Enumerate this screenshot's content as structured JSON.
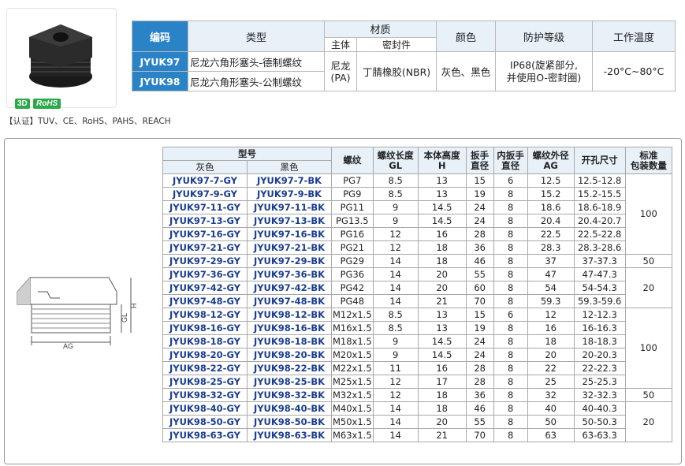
{
  "header_table": {
    "col_code": "编码",
    "col_type": "类型",
    "col_material": "材质",
    "col_material_main": "主体",
    "col_material_seal": "密封件",
    "col_color": "颜色",
    "col_protection": "防护等级",
    "col_temp": "工作温度",
    "rows": [
      {
        "code": "JYUK97",
        "type": "尼龙六角形塞头-德制螺纹"
      },
      {
        "code": "JYUK98",
        "type": "尼龙六角形塞头-公制螺纹"
      }
    ],
    "material_main": "尼龙\n(PA)",
    "material_seal": "丁腈橡胶(NBR)",
    "color": "灰色、黑色",
    "protection": "IP68(旋紧部分,\n并使用O-密封圈)",
    "temp": "-20°C~80°C"
  },
  "badges": {
    "three_d": "3D",
    "rohs": "RoHS"
  },
  "certification": "【认证】TUV、CE、RoHS、PAHS、REACH",
  "drawing_labels": {
    "gl": "GL",
    "h": "H",
    "ag": "AG"
  },
  "spec_table": {
    "model": "型号",
    "gray": "灰色",
    "black": "黑色",
    "thread": "螺纹",
    "gl": "螺纹长度\nGL",
    "h": "本体高度\nH",
    "wrench": "扳手\n直径",
    "inner_wrench": "内扳手\n直径",
    "ag": "螺纹外径\nAG",
    "hole": "开孔尺寸",
    "pack": "标准\n包装数量",
    "rows": [
      [
        "JYUK97-7-GY",
        "JYUK97-7-BK",
        "PG7",
        "8.5",
        "13",
        "15",
        "6",
        "12.5",
        "12.5-12.8"
      ],
      [
        "JYUK97-9-GY",
        "JYUK97-9-BK",
        "PG9",
        "8.5",
        "13",
        "19",
        "8",
        "15.2",
        "15.2-15.5"
      ],
      [
        "JYUK97-11-GY",
        "JYUK97-11-BK",
        "PG11",
        "9",
        "14.5",
        "24",
        "8",
        "18.6",
        "18.6-18.9"
      ],
      [
        "JYUK97-13-GY",
        "JYUK97-13-BK",
        "PG13.5",
        "9",
        "14.5",
        "24",
        "8",
        "20.4",
        "20.4-20.7"
      ],
      [
        "JYUK97-16-GY",
        "JYUK97-16-BK",
        "PG16",
        "12",
        "16",
        "28",
        "8",
        "22.5",
        "22.5-22.8"
      ],
      [
        "JYUK97-21-GY",
        "JYUK97-21-BK",
        "PG21",
        "12",
        "18",
        "36",
        "8",
        "28.3",
        "28.3-28.6"
      ],
      [
        "JYUK97-29-GY",
        "JYUK97-29-BK",
        "PG29",
        "14",
        "18",
        "46",
        "8",
        "37",
        "37-37.3"
      ],
      [
        "JYUK97-36-GY",
        "JYUK97-36-BK",
        "PG36",
        "14",
        "20",
        "55",
        "8",
        "47",
        "47-47.3"
      ],
      [
        "JYUK97-42-GY",
        "JYUK97-42-BK",
        "PG42",
        "14",
        "20",
        "60",
        "8",
        "54",
        "54-54.3"
      ],
      [
        "JYUK97-48-GY",
        "JYUK97-48-BK",
        "PG48",
        "14",
        "21",
        "70",
        "8",
        "59.3",
        "59.3-59.6"
      ],
      [
        "JYUK98-12-GY",
        "JYUK98-12-BK",
        "M12x1.5",
        "8.5",
        "13",
        "15",
        "6",
        "12",
        "12-12.3"
      ],
      [
        "JYUK98-16-GY",
        "JYUK98-16-BK",
        "M16x1.5",
        "8.5",
        "13",
        "19",
        "8",
        "16",
        "16-16.3"
      ],
      [
        "JYUK98-18-GY",
        "JYUK98-18-BK",
        "M18x1.5",
        "9",
        "14.5",
        "24",
        "8",
        "18",
        "18-18.3"
      ],
      [
        "JYUK98-20-GY",
        "JYUK98-20-BK",
        "M20x1.5",
        "9",
        "14.5",
        "24",
        "8",
        "20",
        "20-20.3"
      ],
      [
        "JYUK98-22-GY",
        "JYUK98-22-BK",
        "M22x1.5",
        "11",
        "16",
        "28",
        "8",
        "22",
        "22-22.3"
      ],
      [
        "JYUK98-25-GY",
        "JYUK98-25-BK",
        "M25x1.5",
        "12",
        "17",
        "28",
        "8",
        "25",
        "25-25.3"
      ],
      [
        "JYUK98-32-GY",
        "JYUK98-32-BK",
        "M32x1.5",
        "12",
        "18",
        "36",
        "8",
        "32",
        "32-32.3"
      ],
      [
        "JYUK98-40-GY",
        "JYUK98-40-BK",
        "M40x1.5",
        "14",
        "18",
        "46",
        "8",
        "40",
        "40-40.3"
      ],
      [
        "JYUK98-50-GY",
        "JYUK98-50-BK",
        "M50x1.5",
        "14",
        "20",
        "55",
        "8",
        "50",
        "50-50.3"
      ],
      [
        "JYUK98-63-GY",
        "JYUK98-63-BK",
        "M63x1.5",
        "14",
        "21",
        "70",
        "8",
        "63",
        "63-63.3"
      ]
    ],
    "pack_groups": [
      {
        "rows": 6,
        "value": "100"
      },
      {
        "rows": 1,
        "value": "50"
      },
      {
        "rows": 3,
        "value": "20"
      },
      {
        "rows": 6,
        "value": "100"
      },
      {
        "rows": 1,
        "value": "50"
      },
      {
        "rows": 3,
        "value": "20"
      }
    ]
  },
  "colors": {
    "accent": "#2a82c7",
    "header_bg": "#e8f0f8",
    "code_text": "#1a3d8f",
    "badge": "#2aa84a"
  }
}
